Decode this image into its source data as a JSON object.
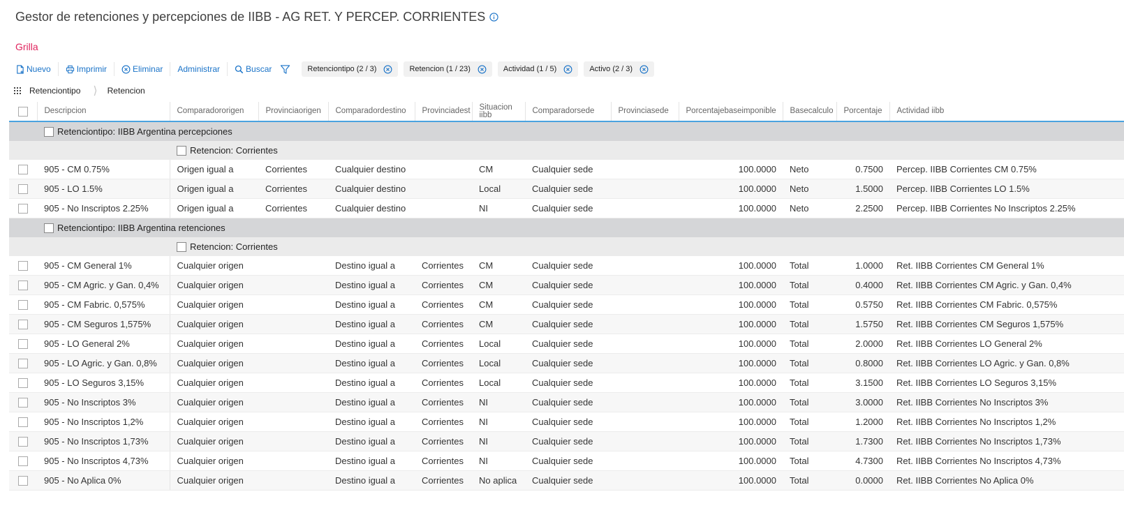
{
  "page": {
    "title": "Gestor de retenciones y percepciones de IIBB - AG RET. Y PERCEP. CORRIENTES",
    "section": "Grilla"
  },
  "toolbar": {
    "nuevo": "Nuevo",
    "imprimir": "Imprimir",
    "eliminar": "Eliminar",
    "administrar": "Administrar",
    "buscar": "Buscar"
  },
  "filters": [
    "Retenciontipo (2 / 3)",
    "Retencion (1 / 23)",
    "Actividad (1 / 5)",
    "Activo (2 / 3)"
  ],
  "grouping": [
    "Retenciontipo",
    "Retencion"
  ],
  "columns": [
    "Descripcion",
    "Comparadororigen",
    "Provinciaorigen",
    "Comparadordestino",
    "Provinciadest",
    "Situacion iibb",
    "Comparadorsede",
    "Provinciasede",
    "Porcentajebaseimponible",
    "Basecalculo",
    "Porcentaje",
    "Actividad iibb"
  ],
  "groups": [
    {
      "label": "Retenciontipo: IIBB Argentina percepciones",
      "subgroup": "Retencion: Corrientes",
      "rows": [
        [
          "905 - CM 0.75%",
          "Origen igual a",
          "Corrientes",
          "Cualquier destino",
          "",
          "CM",
          "Cualquier sede",
          "",
          "100.0000",
          "Neto",
          "0.7500",
          "Percep. IIBB Corrientes CM 0.75%"
        ],
        [
          "905 - LO 1.5%",
          "Origen igual a",
          "Corrientes",
          "Cualquier destino",
          "",
          "Local",
          "Cualquier sede",
          "",
          "100.0000",
          "Neto",
          "1.5000",
          "Percep. IIBB Corrientes LO 1.5%"
        ],
        [
          "905 - No Inscriptos 2.25%",
          "Origen igual a",
          "Corrientes",
          "Cualquier destino",
          "",
          "NI",
          "Cualquier sede",
          "",
          "100.0000",
          "Neto",
          "2.2500",
          "Percep. IIBB Corrientes No Inscriptos 2.25%"
        ]
      ]
    },
    {
      "label": "Retenciontipo: IIBB Argentina retenciones",
      "subgroup": "Retencion: Corrientes",
      "rows": [
        [
          "905 - CM General 1%",
          "Cualquier origen",
          "",
          "Destino igual a",
          "Corrientes",
          "CM",
          "Cualquier sede",
          "",
          "100.0000",
          "Total",
          "1.0000",
          "Ret. IIBB Corrientes CM General 1%"
        ],
        [
          "905 - CM Agric. y Gan. 0,4%",
          "Cualquier origen",
          "",
          "Destino igual a",
          "Corrientes",
          "CM",
          "Cualquier sede",
          "",
          "100.0000",
          "Total",
          "0.4000",
          "Ret. IIBB Corrientes CM Agric. y Gan. 0,4%"
        ],
        [
          "905 - CM Fabric. 0,575%",
          "Cualquier origen",
          "",
          "Destino igual a",
          "Corrientes",
          "CM",
          "Cualquier sede",
          "",
          "100.0000",
          "Total",
          "0.5750",
          "Ret. IIBB Corrientes CM Fabric. 0,575%"
        ],
        [
          "905 - CM Seguros 1,575%",
          "Cualquier origen",
          "",
          "Destino igual a",
          "Corrientes",
          "CM",
          "Cualquier sede",
          "",
          "100.0000",
          "Total",
          "1.5750",
          "Ret. IIBB Corrientes CM Seguros 1,575%"
        ],
        [
          "905 - LO General 2%",
          "Cualquier origen",
          "",
          "Destino igual a",
          "Corrientes",
          "Local",
          "Cualquier sede",
          "",
          "100.0000",
          "Total",
          "2.0000",
          "Ret. IIBB Corrientes LO General 2%"
        ],
        [
          "905 - LO Agric. y Gan. 0,8%",
          "Cualquier origen",
          "",
          "Destino igual a",
          "Corrientes",
          "Local",
          "Cualquier sede",
          "",
          "100.0000",
          "Total",
          "0.8000",
          "Ret. IIBB Corrientes LO Agric. y Gan. 0,8%"
        ],
        [
          "905 - LO Seguros 3,15%",
          "Cualquier origen",
          "",
          "Destino igual a",
          "Corrientes",
          "Local",
          "Cualquier sede",
          "",
          "100.0000",
          "Total",
          "3.1500",
          "Ret. IIBB Corrientes LO Seguros 3,15%"
        ],
        [
          "905 - No Inscriptos 3%",
          "Cualquier origen",
          "",
          "Destino igual a",
          "Corrientes",
          "NI",
          "Cualquier sede",
          "",
          "100.0000",
          "Total",
          "3.0000",
          "Ret. IIBB Corrientes No Inscriptos 3%"
        ],
        [
          "905 - No Inscriptos 1,2%",
          "Cualquier origen",
          "",
          "Destino igual a",
          "Corrientes",
          "NI",
          "Cualquier sede",
          "",
          "100.0000",
          "Total",
          "1.2000",
          "Ret. IIBB Corrientes No Inscriptos 1,2%"
        ],
        [
          "905 - No Inscriptos 1,73%",
          "Cualquier origen",
          "",
          "Destino igual a",
          "Corrientes",
          "NI",
          "Cualquier sede",
          "",
          "100.0000",
          "Total",
          "1.7300",
          "Ret. IIBB Corrientes No Inscriptos 1,73%"
        ],
        [
          "905 - No Inscriptos 4,73%",
          "Cualquier origen",
          "",
          "Destino igual a",
          "Corrientes",
          "NI",
          "Cualquier sede",
          "",
          "100.0000",
          "Total",
          "4.7300",
          "Ret. IIBB Corrientes No Inscriptos 4,73%"
        ],
        [
          "905 - No Aplica 0%",
          "Cualquier origen",
          "",
          "Destino igual a",
          "Corrientes",
          "No aplica",
          "Cualquier sede",
          "",
          "100.0000",
          "Total",
          "0.0000",
          "Ret. IIBB Corrientes No Aplica 0%"
        ]
      ]
    }
  ]
}
